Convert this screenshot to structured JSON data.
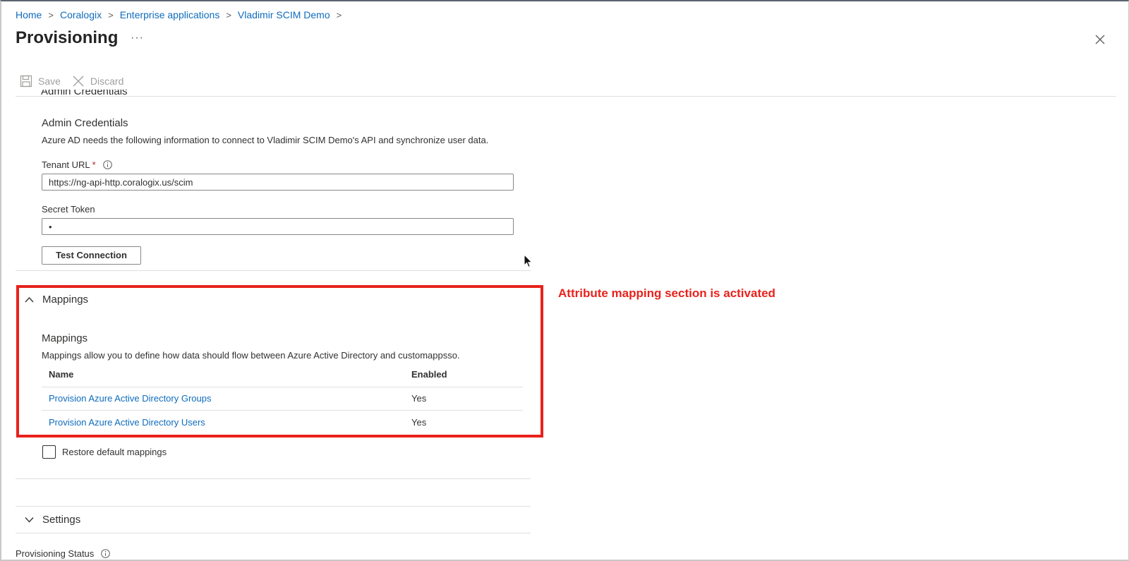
{
  "breadcrumb": [
    {
      "label": "Home"
    },
    {
      "label": "Coralogix"
    },
    {
      "label": "Enterprise applications"
    },
    {
      "label": "Vladimir SCIM Demo"
    }
  ],
  "page": {
    "title": "Provisioning",
    "more": "···"
  },
  "toolbar": {
    "save_label": "Save",
    "discard_label": "Discard"
  },
  "admin": {
    "section_label": "Admin Credentials",
    "title": "Admin Credentials",
    "description": "Azure AD needs the following information to connect to Vladimir SCIM Demo's API and synchronize user data.",
    "tenant_url_label": "Tenant URL",
    "required_mark": "*",
    "tenant_url_value": "https://ng-api-http.coralogix.us/scim",
    "secret_token_label": "Secret Token",
    "secret_token_value": "•",
    "test_connection_label": "Test Connection"
  },
  "mappings": {
    "section_label": "Mappings",
    "title": "Mappings",
    "description": "Mappings allow you to define how data should flow between Azure Active Directory and customappsso.",
    "columns": {
      "name": "Name",
      "enabled": "Enabled"
    },
    "rows": [
      {
        "name": "Provision Azure Active Directory Groups",
        "enabled": "Yes"
      },
      {
        "name": "Provision Azure Active Directory Users",
        "enabled": "Yes"
      }
    ],
    "restore_label": "Restore default mappings",
    "restore_checked": false
  },
  "annotation": {
    "text": "Attribute mapping section is activated",
    "color": "#e8221c"
  },
  "settings": {
    "section_label": "Settings"
  },
  "provisioning_status": {
    "label": "Provisioning Status"
  },
  "colors": {
    "link": "#0f6cbd",
    "highlight": "#e8221c"
  }
}
